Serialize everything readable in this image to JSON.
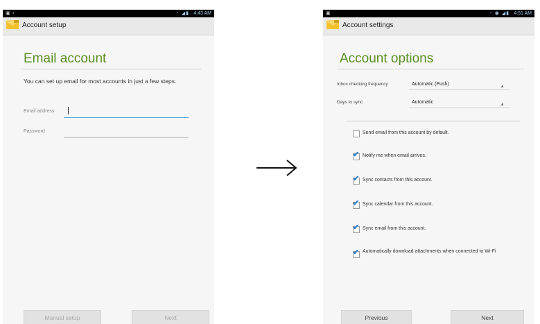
{
  "left_screen": {
    "status_time": "4:43 AM",
    "action_title": "Account setup",
    "heading": "Email account",
    "intro": "You can set up email for most accounts in just a few steps.",
    "email_label": "Email address",
    "password_label": "Password",
    "manual_setup": "Manual setup",
    "next": "Next"
  },
  "right_screen": {
    "status_time": "4:51 AM",
    "action_title": "Account settings",
    "heading": "Account options",
    "inbox_label": "Inbox checking frequency",
    "inbox_value": "Automatic (Push)",
    "days_label": "Days to sync",
    "days_value": "Automatic",
    "checkboxes": [
      {
        "label": "Send email from this account by default.",
        "checked": false
      },
      {
        "label": "Notify me when email arrives.",
        "checked": true
      },
      {
        "label": "Sync contacts from this account.",
        "checked": true
      },
      {
        "label": "Sync calendar from this account.",
        "checked": true
      },
      {
        "label": "Sync email from this account.",
        "checked": true
      },
      {
        "label": "Automatically download attachments when connected to Wi-Fi",
        "checked": true
      }
    ],
    "previous": "Previous",
    "next": "Next"
  },
  "colors": {
    "heading": "#5a8f21",
    "check": "#2f7fcb",
    "focus_line": "#4fa9d6"
  }
}
